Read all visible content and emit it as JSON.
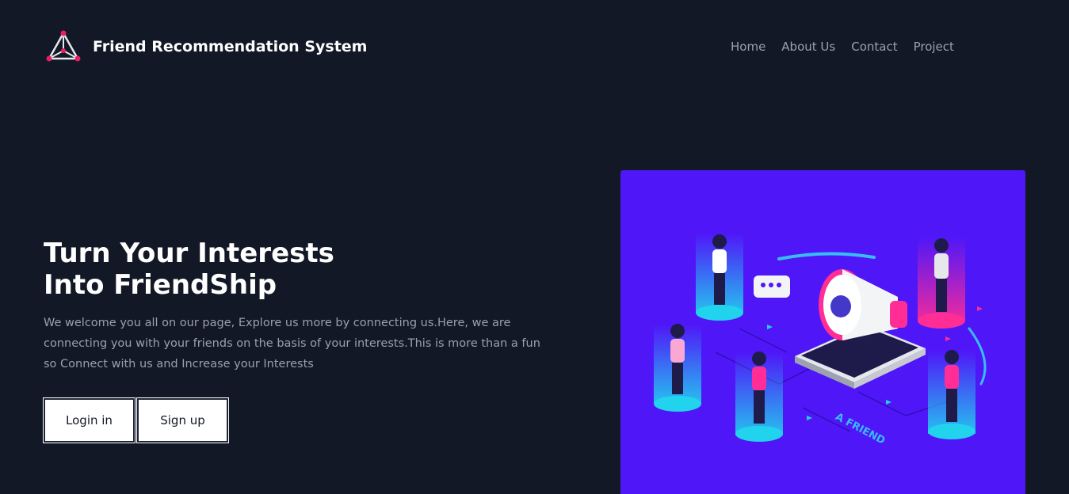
{
  "header": {
    "brand": "Friend Recommendation System",
    "logo_icon": "network-triangle-icon",
    "nav": [
      "Home",
      "About Us",
      "Contact",
      "Project"
    ]
  },
  "hero": {
    "title_line1": "Turn Your Interests",
    "title_line2": "Into FriendShip",
    "description": "We welcome you all on our page, Explore us more by connecting us.Here, we are connecting you with your friends on the basis of your interests.This is more than a fun so Connect with us and Increase your Interests",
    "login_label": "Login in",
    "signup_label": "Sign up"
  },
  "illustration": {
    "caption": "A FRIEND",
    "background": "#4f17f8"
  },
  "colors": {
    "background": "#131826",
    "text_muted": "#9aa0ab",
    "accent_pink": "#e91e63",
    "accent_cyan": "#22d3ee"
  }
}
